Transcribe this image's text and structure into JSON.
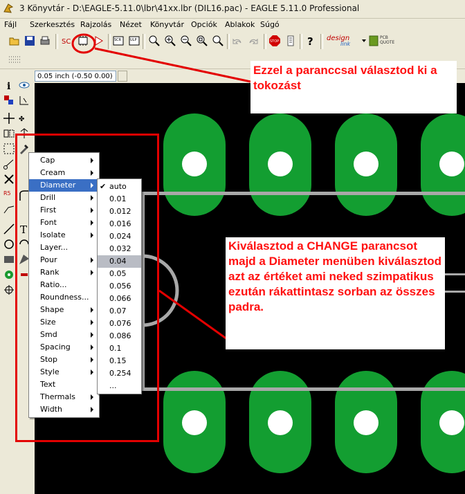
{
  "window": {
    "title": "3 Könyvtár - D:\\EAGLE-5.11.0\\lbr\\41xx.lbr (DIL16.pac) - EAGLE 5.11.0 Professional"
  },
  "menubar": [
    "Fájl",
    "Szerkesztés",
    "Rajzolás",
    "Nézet",
    "Könyvtár",
    "Opciók",
    "Ablakok",
    "Súgó"
  ],
  "toolbar": {
    "icons": [
      "open-icon",
      "save-icon",
      "print-icon",
      "script-icon",
      "package-icon",
      "run-icon",
      "ulp-icon",
      "export-icon",
      "zoom-fit-icon",
      "zoom-in-icon",
      "zoom-out-icon",
      "zoom-select-icon",
      "zoom-redraw-icon",
      "undo-icon",
      "redo-icon",
      "stop-icon",
      "go-icon",
      "help-icon"
    ],
    "designlink_label": "design",
    "designlink_sub": "link",
    "pcbquote_label": "PCB QUOTE"
  },
  "coordinate_display": "0.05 inch (-0.50 0.00)",
  "change_menu": {
    "items": [
      {
        "label": "Cap",
        "submenu": true
      },
      {
        "label": "Cream",
        "submenu": true
      },
      {
        "label": "Diameter",
        "submenu": true
      },
      {
        "label": "Drill",
        "submenu": true
      },
      {
        "label": "First",
        "submenu": true
      },
      {
        "label": "Font",
        "submenu": true
      },
      {
        "label": "Isolate",
        "submenu": true
      },
      {
        "label": "Layer...",
        "submenu": false
      },
      {
        "label": "Pour",
        "submenu": true
      },
      {
        "label": "Rank",
        "submenu": true
      },
      {
        "label": "Ratio...",
        "submenu": false
      },
      {
        "label": "Roundness...",
        "submenu": false
      },
      {
        "label": "Shape",
        "submenu": true
      },
      {
        "label": "Size",
        "submenu": true
      },
      {
        "label": "Smd",
        "submenu": true
      },
      {
        "label": "Spacing",
        "submenu": true
      },
      {
        "label": "Stop",
        "submenu": true
      },
      {
        "label": "Style",
        "submenu": true
      },
      {
        "label": "Text",
        "submenu": false
      },
      {
        "label": "Thermals",
        "submenu": true
      },
      {
        "label": "Width",
        "submenu": true
      }
    ],
    "highlighted": "Diameter"
  },
  "diameter_submenu": {
    "items": [
      "auto",
      "0.01",
      "0.012",
      "0.016",
      "0.024",
      "0.032",
      "0.04",
      "0.05",
      "0.056",
      "0.066",
      "0.07",
      "0.076",
      "0.086",
      "0.1",
      "0.15",
      "0.254",
      "..."
    ],
    "checked": "auto",
    "hover": "0.04"
  },
  "annotations": {
    "top": "Ezzel a paranccsal választod ki a tokozást",
    "middle": "Kiválasztod a CHANGE parancsot majd a Diameter menüben kiválasztod azt az értéket ami neked szimpatikus ezután rákattintasz sorban az összes padra."
  },
  "colors": {
    "pad": "#139e31",
    "annotation_red": "#ff1010",
    "highlight": "#3a6fc4",
    "canvas": "#000000"
  }
}
